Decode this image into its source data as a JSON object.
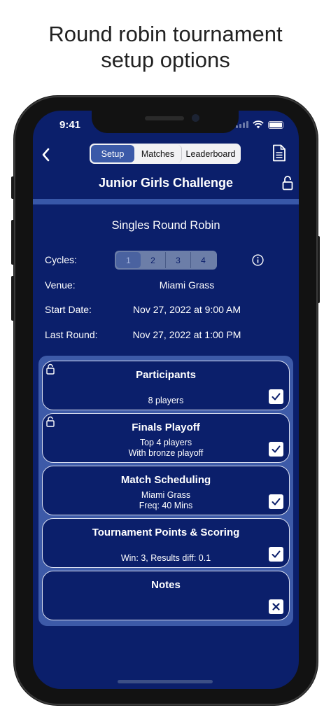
{
  "headline": {
    "line1": "Round robin tournament",
    "line2": "setup options"
  },
  "status_bar": {
    "time": "9:41",
    "icons": [
      "signal-icon",
      "wifi-icon",
      "battery-icon"
    ]
  },
  "nav": {
    "back_icon": "chevron-left-icon",
    "tabs": [
      "Setup",
      "Matches",
      "Leaderboard"
    ],
    "selected_tab": "Setup",
    "document_icon": "document-icon",
    "title": "Junior Girls Challenge",
    "lock_icon": "lock-open-icon"
  },
  "tournament": {
    "format": "Singles Round Robin",
    "cycles": {
      "label": "Cycles:",
      "options": [
        "1",
        "2",
        "3",
        "4"
      ],
      "selected": "1",
      "info_icon": "info-icon"
    },
    "venue": {
      "label": "Venue:",
      "value": "Miami Grass"
    },
    "start_date": {
      "label": "Start Date:",
      "value": "Nov 27, 2022 at 9:00 AM"
    },
    "last_round": {
      "label": "Last Round:",
      "value": "Nov 27, 2022 at 1:00 PM"
    }
  },
  "cards": [
    {
      "title": "Participants",
      "lines": [
        "8 players"
      ],
      "locked": true,
      "state": "checked"
    },
    {
      "title": "Finals Playoff",
      "lines": [
        "Top 4 players",
        "With bronze playoff"
      ],
      "locked": true,
      "state": "checked"
    },
    {
      "title": "Match Scheduling",
      "lines": [
        "Miami Grass",
        "Freq: 40 Mins"
      ],
      "locked": false,
      "state": "checked"
    },
    {
      "title": "Tournament Points & Scoring",
      "lines": [
        "Win: 3, Results diff: 0.1"
      ],
      "locked": false,
      "state": "checked"
    },
    {
      "title": "Notes",
      "lines": [],
      "locked": false,
      "state": "crossed"
    }
  ],
  "colors": {
    "background": "#0b1f6b",
    "accent": "#3b5aa8",
    "panel": "#3d5aa8",
    "segment": "#f2f2f4"
  }
}
